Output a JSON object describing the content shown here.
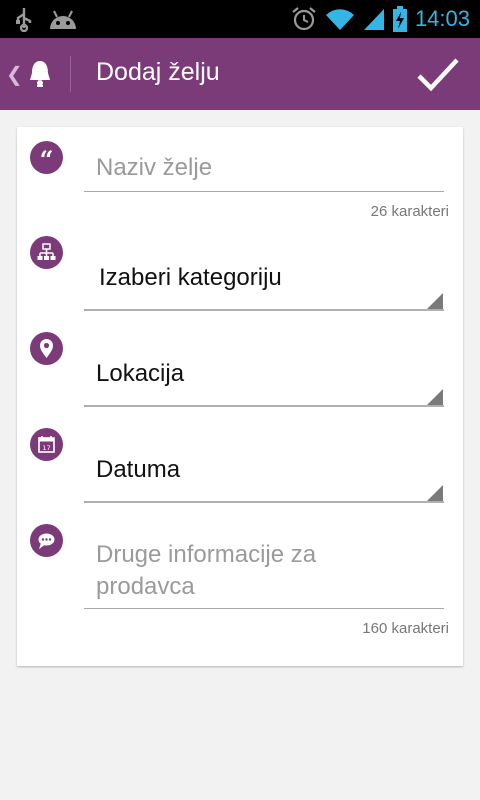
{
  "status_bar": {
    "time": "14:03",
    "icons": [
      "usb-icon",
      "android-icon",
      "alarm-icon",
      "wifi-icon",
      "signal-icon",
      "battery-charging-icon"
    ]
  },
  "action_bar": {
    "title": "Dodaj želju",
    "icons": [
      "back-chevron-icon",
      "bell-app-icon",
      "confirm-check-icon"
    ]
  },
  "form": {
    "wish_name": {
      "placeholder": "Naziv želje",
      "counter": "26 karakteri",
      "icon": "quote-icon"
    },
    "category": {
      "value": "Izaberi kategoriju",
      "icon": "hierarchy-icon"
    },
    "location": {
      "value": "Lokacija",
      "icon": "location-pin-icon"
    },
    "date": {
      "value": "Datuma",
      "icon": "calendar-icon"
    },
    "seller_info": {
      "placeholder": "Druge informacije za\nprodavca",
      "counter": "160 karakteri",
      "icon": "speech-bubble-icon"
    }
  },
  "colors": {
    "accent": "#7b3b79",
    "status_time": "#33b5e5",
    "background": "#f2f2f2"
  }
}
